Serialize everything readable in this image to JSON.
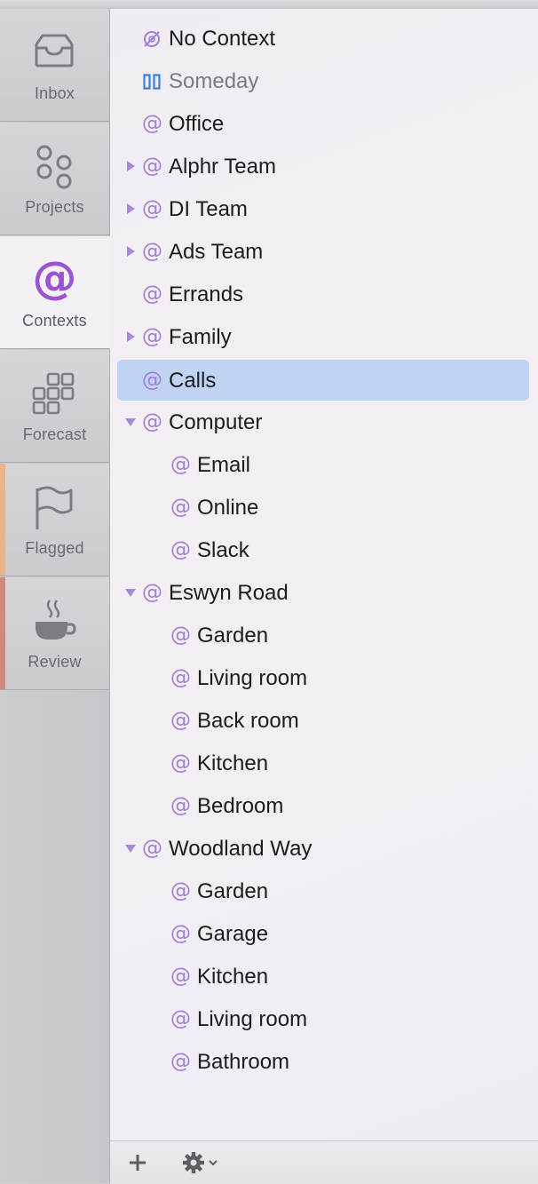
{
  "tabs": [
    {
      "id": "inbox",
      "label": "Inbox",
      "icon": "inbox-tray-icon"
    },
    {
      "id": "projects",
      "label": "Projects",
      "icon": "projects-circles-icon"
    },
    {
      "id": "contexts",
      "label": "Contexts",
      "icon": "at-sign-icon",
      "active": true
    },
    {
      "id": "forecast",
      "label": "Forecast",
      "icon": "forecast-grid-icon"
    },
    {
      "id": "flagged",
      "label": "Flagged",
      "icon": "flag-icon"
    },
    {
      "id": "review",
      "label": "Review",
      "icon": "coffee-cup-icon"
    }
  ],
  "contexts": [
    {
      "label": "No Context",
      "icon": "no-context-icon",
      "level": 0
    },
    {
      "label": "Someday",
      "icon": "pause-icon",
      "level": 0,
      "dimmed": true
    },
    {
      "label": "Office",
      "icon": "at-icon",
      "level": 0
    },
    {
      "label": "Alphr Team",
      "icon": "at-icon",
      "level": 0,
      "disclosure": "collapsed"
    },
    {
      "label": "DI Team",
      "icon": "at-icon",
      "level": 0,
      "disclosure": "collapsed"
    },
    {
      "label": "Ads Team",
      "icon": "at-icon",
      "level": 0,
      "disclosure": "collapsed"
    },
    {
      "label": "Errands",
      "icon": "at-icon",
      "level": 0
    },
    {
      "label": "Family",
      "icon": "at-icon",
      "level": 0,
      "disclosure": "collapsed"
    },
    {
      "label": "Calls",
      "icon": "at-icon",
      "level": 0,
      "selected": true
    },
    {
      "label": "Computer",
      "icon": "at-icon",
      "level": 0,
      "disclosure": "expanded"
    },
    {
      "label": "Email",
      "icon": "at-icon",
      "level": 1
    },
    {
      "label": "Online",
      "icon": "at-icon",
      "level": 1
    },
    {
      "label": "Slack",
      "icon": "at-icon",
      "level": 1
    },
    {
      "label": "Eswyn Road",
      "icon": "at-icon",
      "level": 0,
      "disclosure": "expanded"
    },
    {
      "label": "Garden",
      "icon": "at-icon",
      "level": 1
    },
    {
      "label": "Living room",
      "icon": "at-icon",
      "level": 1
    },
    {
      "label": "Back room",
      "icon": "at-icon",
      "level": 1
    },
    {
      "label": "Kitchen",
      "icon": "at-icon",
      "level": 1
    },
    {
      "label": "Bedroom",
      "icon": "at-icon",
      "level": 1
    },
    {
      "label": "Woodland Way",
      "icon": "at-icon",
      "level": 0,
      "disclosure": "expanded"
    },
    {
      "label": "Garden",
      "icon": "at-icon",
      "level": 1
    },
    {
      "label": "Garage",
      "icon": "at-icon",
      "level": 1
    },
    {
      "label": "Kitchen",
      "icon": "at-icon",
      "level": 1
    },
    {
      "label": "Living room",
      "icon": "at-icon",
      "level": 1
    },
    {
      "label": "Bathroom",
      "icon": "at-icon",
      "level": 1
    }
  ],
  "toolbar": {
    "add_icon": "plus-icon",
    "settings_icon": "gear-icon",
    "at_glyph": "@"
  },
  "colors": {
    "accent": "#a27fd6",
    "selection": "#bfd3f3",
    "flagged_stripe": "#e8b48a",
    "review_stripe": "#cf8a7c"
  }
}
